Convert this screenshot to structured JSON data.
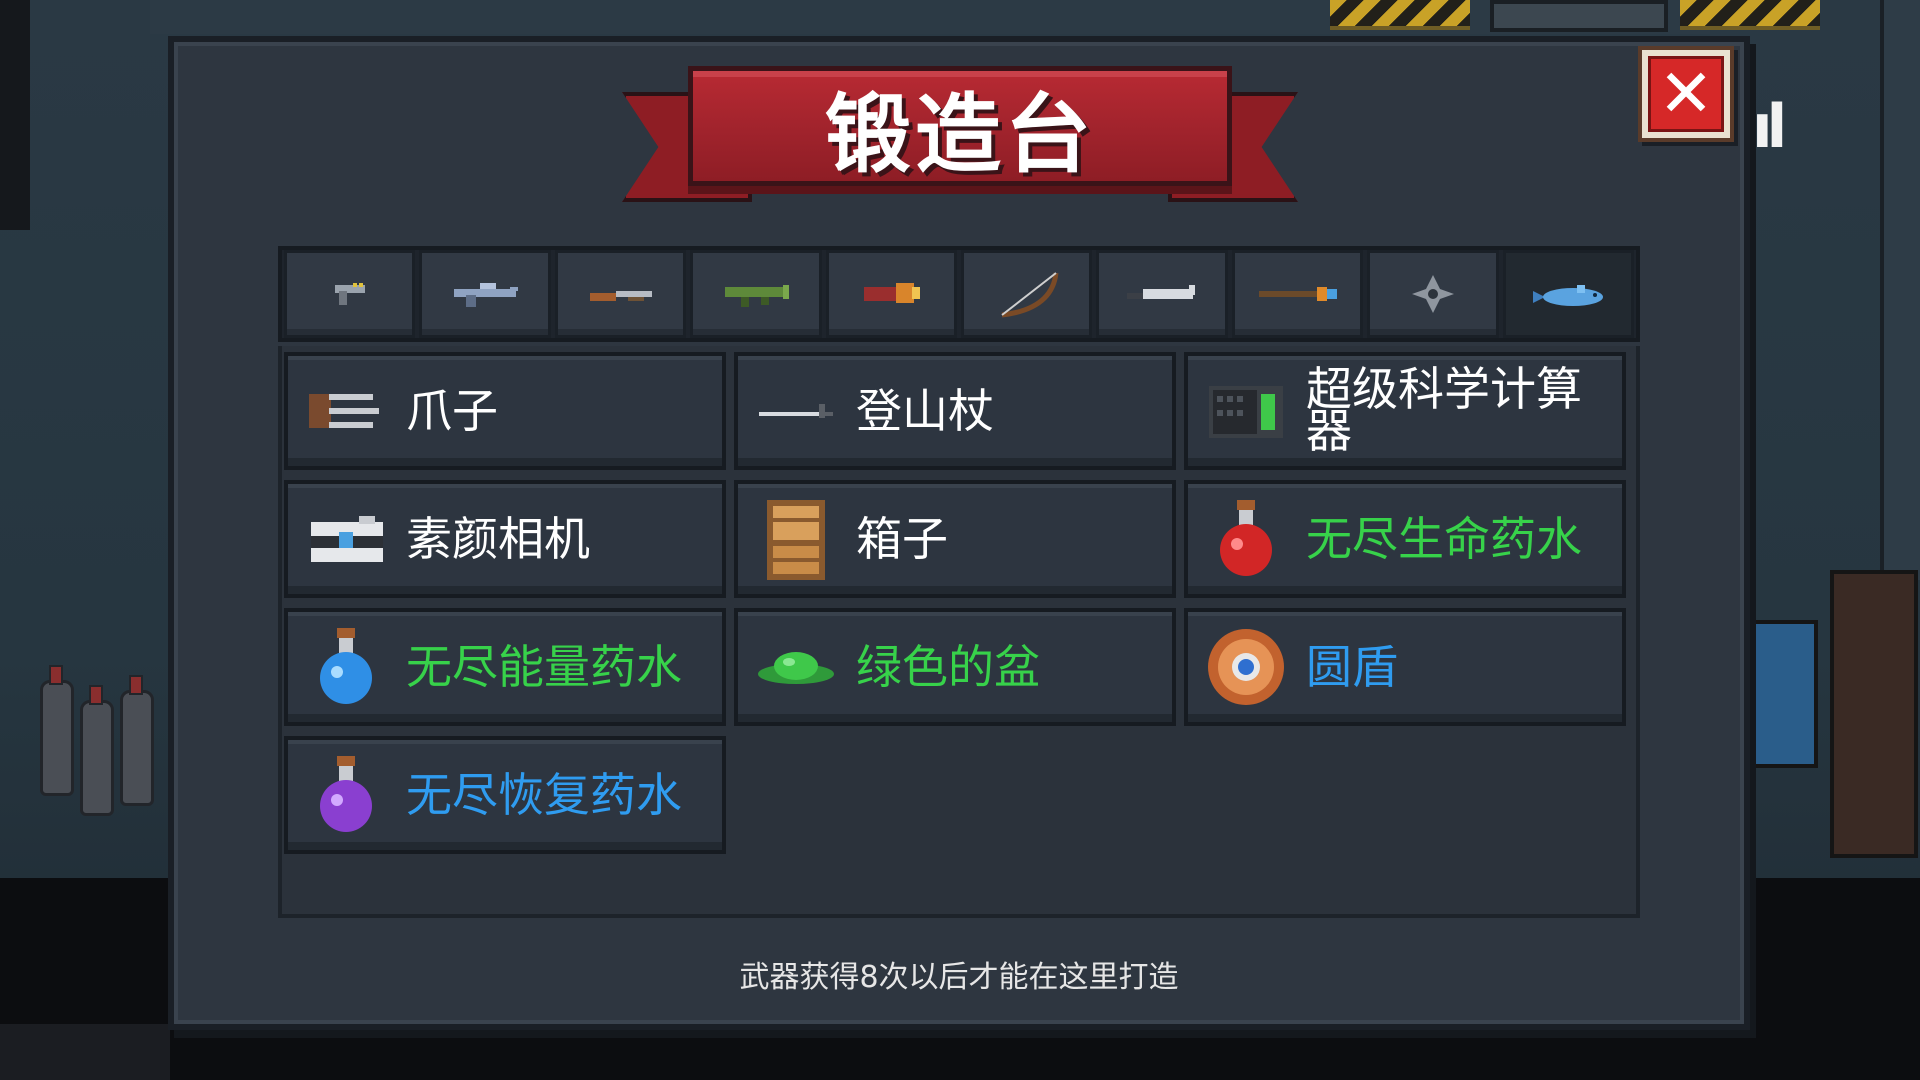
{
  "dialog": {
    "title": "锻造台",
    "close_symbol": "✕",
    "footer_note": "武器获得8次以后才能在这里打造"
  },
  "colors": {
    "white_text": "#ffffff",
    "green_text": "#37d24a",
    "blue_text": "#2f9cf0",
    "banner_red": "#a0232c",
    "close_red": "#d62828"
  },
  "tabs": [
    {
      "icon": "pistol-icon",
      "active": false
    },
    {
      "icon": "rifle-icon",
      "active": false
    },
    {
      "icon": "shotgun-icon",
      "active": false
    },
    {
      "icon": "launcher-icon",
      "active": false
    },
    {
      "icon": "heavy-gun-icon",
      "active": false
    },
    {
      "icon": "bow-icon",
      "active": false
    },
    {
      "icon": "sword-icon",
      "active": false
    },
    {
      "icon": "staff-icon",
      "active": false
    },
    {
      "icon": "shuriken-icon",
      "active": false
    },
    {
      "icon": "fish-icon",
      "active": true
    }
  ],
  "items": [
    {
      "label": "爪子",
      "icon": "claw-icon",
      "color": "#ffffff"
    },
    {
      "label": "登山杖",
      "icon": "hiking-stick-icon",
      "color": "#ffffff"
    },
    {
      "label": "超级科学计算器",
      "icon": "calculator-icon",
      "color": "#ffffff"
    },
    {
      "label": "素颜相机",
      "icon": "camera-icon",
      "color": "#ffffff"
    },
    {
      "label": "箱子",
      "icon": "crate-icon",
      "color": "#ffffff"
    },
    {
      "label": "无尽生命药水",
      "icon": "red-potion-icon",
      "color": "#37d24a"
    },
    {
      "label": "无尽能量药水",
      "icon": "blue-potion-icon",
      "color": "#37d24a"
    },
    {
      "label": "绿色的盆",
      "icon": "green-basin-icon",
      "color": "#37d24a"
    },
    {
      "label": "圆盾",
      "icon": "round-shield-icon",
      "color": "#2f9cf0"
    },
    {
      "label": "无尽恢复药水",
      "icon": "purple-potion-icon",
      "color": "#2f9cf0"
    }
  ]
}
